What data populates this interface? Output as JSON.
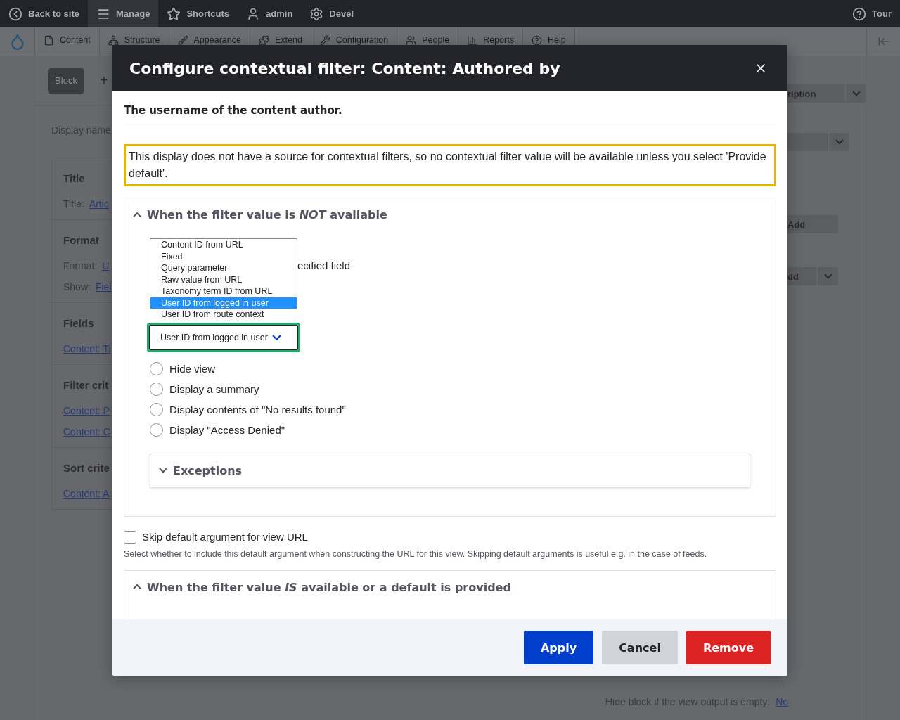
{
  "toolbar": {
    "items": [
      {
        "label": "Back to site",
        "selected": false
      },
      {
        "label": "Manage",
        "selected": true
      },
      {
        "label": "Shortcuts",
        "selected": false
      },
      {
        "label": "admin",
        "selected": false
      },
      {
        "label": "Devel",
        "selected": false
      }
    ],
    "tour": "Tour"
  },
  "admin_menu": {
    "items": [
      {
        "label": "Content"
      },
      {
        "label": "Structure"
      },
      {
        "label": "Appearance"
      },
      {
        "label": "Extend"
      },
      {
        "label": "Configuration"
      },
      {
        "label": "People"
      },
      {
        "label": "Reports"
      },
      {
        "label": "Help"
      }
    ]
  },
  "background": {
    "left": {
      "block_button": "Block",
      "add_mark": "+",
      "display_name": "Display name",
      "sections": [
        {
          "title": "Title",
          "rows": [
            {
              "label": "Title:",
              "link": "Artic"
            }
          ]
        },
        {
          "title": "Format",
          "rows": [
            {
              "label": "Format:",
              "link": "U"
            },
            {
              "label": "Show:",
              "link": "Fiel"
            }
          ]
        },
        {
          "title": "Fields",
          "rows": [
            {
              "link": "Content: Ti"
            }
          ]
        },
        {
          "title": "Filter crit",
          "rows": [
            {
              "link": "Content: P"
            },
            {
              "link": "Content: C"
            }
          ]
        },
        {
          "title": "Sort crite",
          "rows": [
            {
              "link": "Content: A"
            }
          ]
        }
      ]
    },
    "right": {
      "buttons": [
        {
          "label": "ription",
          "kind": "split"
        },
        {
          "kind": "split"
        },
        {
          "label": "Add",
          "kind": "plain"
        },
        {
          "label": "dd",
          "kind": "split"
        }
      ]
    },
    "bottom_row": {
      "label": "Hide block if the view output is empty:",
      "link": "No"
    }
  },
  "dialog": {
    "title": "Configure contextual filter: Content: Authored by",
    "description": "The username of the content author.",
    "warning": "This display does not have a source for contextual filters, so no contextual filter value will be available unless you select 'Provide default'.",
    "not_available": {
      "title": "When the filter value is *NOT* available",
      "expanded": true,
      "partial_label": "ecified field",
      "select": {
        "options": [
          {
            "label": "Content ID from URL",
            "selected": false
          },
          {
            "label": "Fixed",
            "selected": false
          },
          {
            "label": "Query parameter",
            "selected": false
          },
          {
            "label": "Raw value from URL",
            "selected": false
          },
          {
            "label": "Taxonomy term ID from URL",
            "selected": false
          },
          {
            "label": "User ID from logged in user",
            "selected": true
          },
          {
            "label": "User ID from route context",
            "selected": false
          }
        ],
        "value": "User ID from logged in user"
      },
      "radios": [
        {
          "label": "Hide view",
          "selected": false
        },
        {
          "label": "Display a summary",
          "selected": false
        },
        {
          "label": "Display contents of \"No results found\"",
          "selected": false
        },
        {
          "label": "Display \"Access Denied\"",
          "selected": false
        }
      ],
      "exceptions": {
        "title": "Exceptions",
        "expanded": false
      }
    },
    "skip_default": {
      "label": "Skip default argument for view URL",
      "checked": false,
      "help": "Select whether to include this default argument when constructing the URL for this view. Skipping default arguments is useful e.g. in the case of feeds."
    },
    "available": {
      "title": "When the filter value *IS* available or a default is provided",
      "expanded": true
    },
    "buttons": [
      {
        "label": "Apply",
        "kind": "primary"
      },
      {
        "label": "Cancel",
        "kind": "secondary"
      },
      {
        "label": "Remove",
        "kind": "danger"
      }
    ]
  }
}
